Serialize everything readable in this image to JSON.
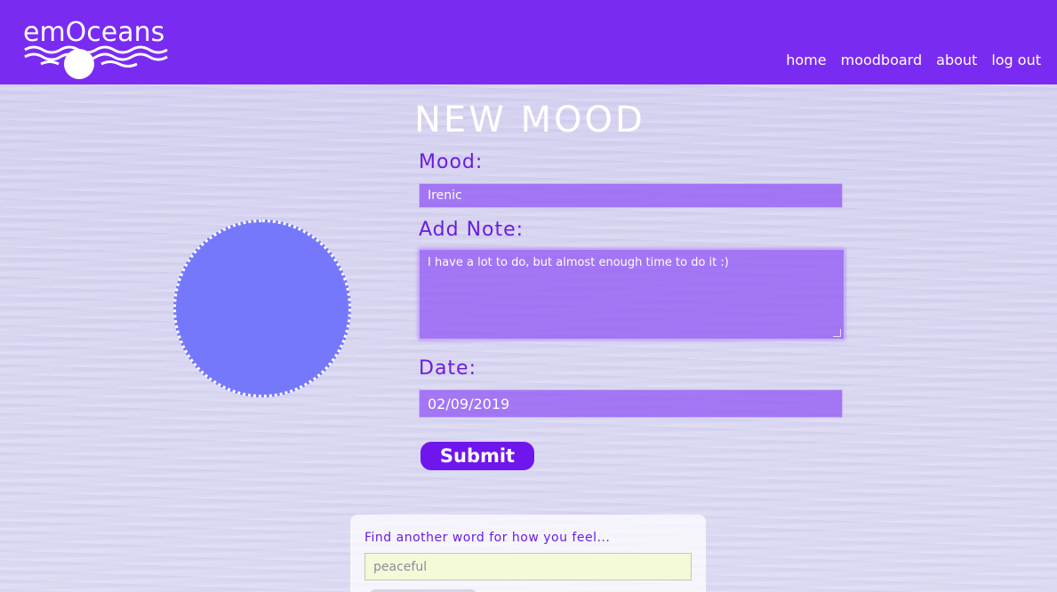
{
  "brand": {
    "name": "emOceans"
  },
  "nav": {
    "home": "home",
    "moodboard": "moodboard",
    "about": "about",
    "logout": "log out"
  },
  "page": {
    "title": "New Mood"
  },
  "form": {
    "mood_label": "Mood:",
    "mood_value": "Irenic",
    "note_label": "Add Note:",
    "note_value": "I have a lot to do, but almost enough time to do it :)",
    "date_label": "Date:",
    "date_value": "02/09/2019",
    "submit_label": "Submit"
  },
  "mood_swatch": {
    "color": "#7678fb"
  },
  "thesaurus": {
    "prompt": "Find another word for how you feel...",
    "input_value": "peaceful"
  },
  "colors": {
    "header": "#7a2bf2",
    "accent": "#6a1de0",
    "field": "#8d50f5",
    "button": "#6f16ec"
  }
}
